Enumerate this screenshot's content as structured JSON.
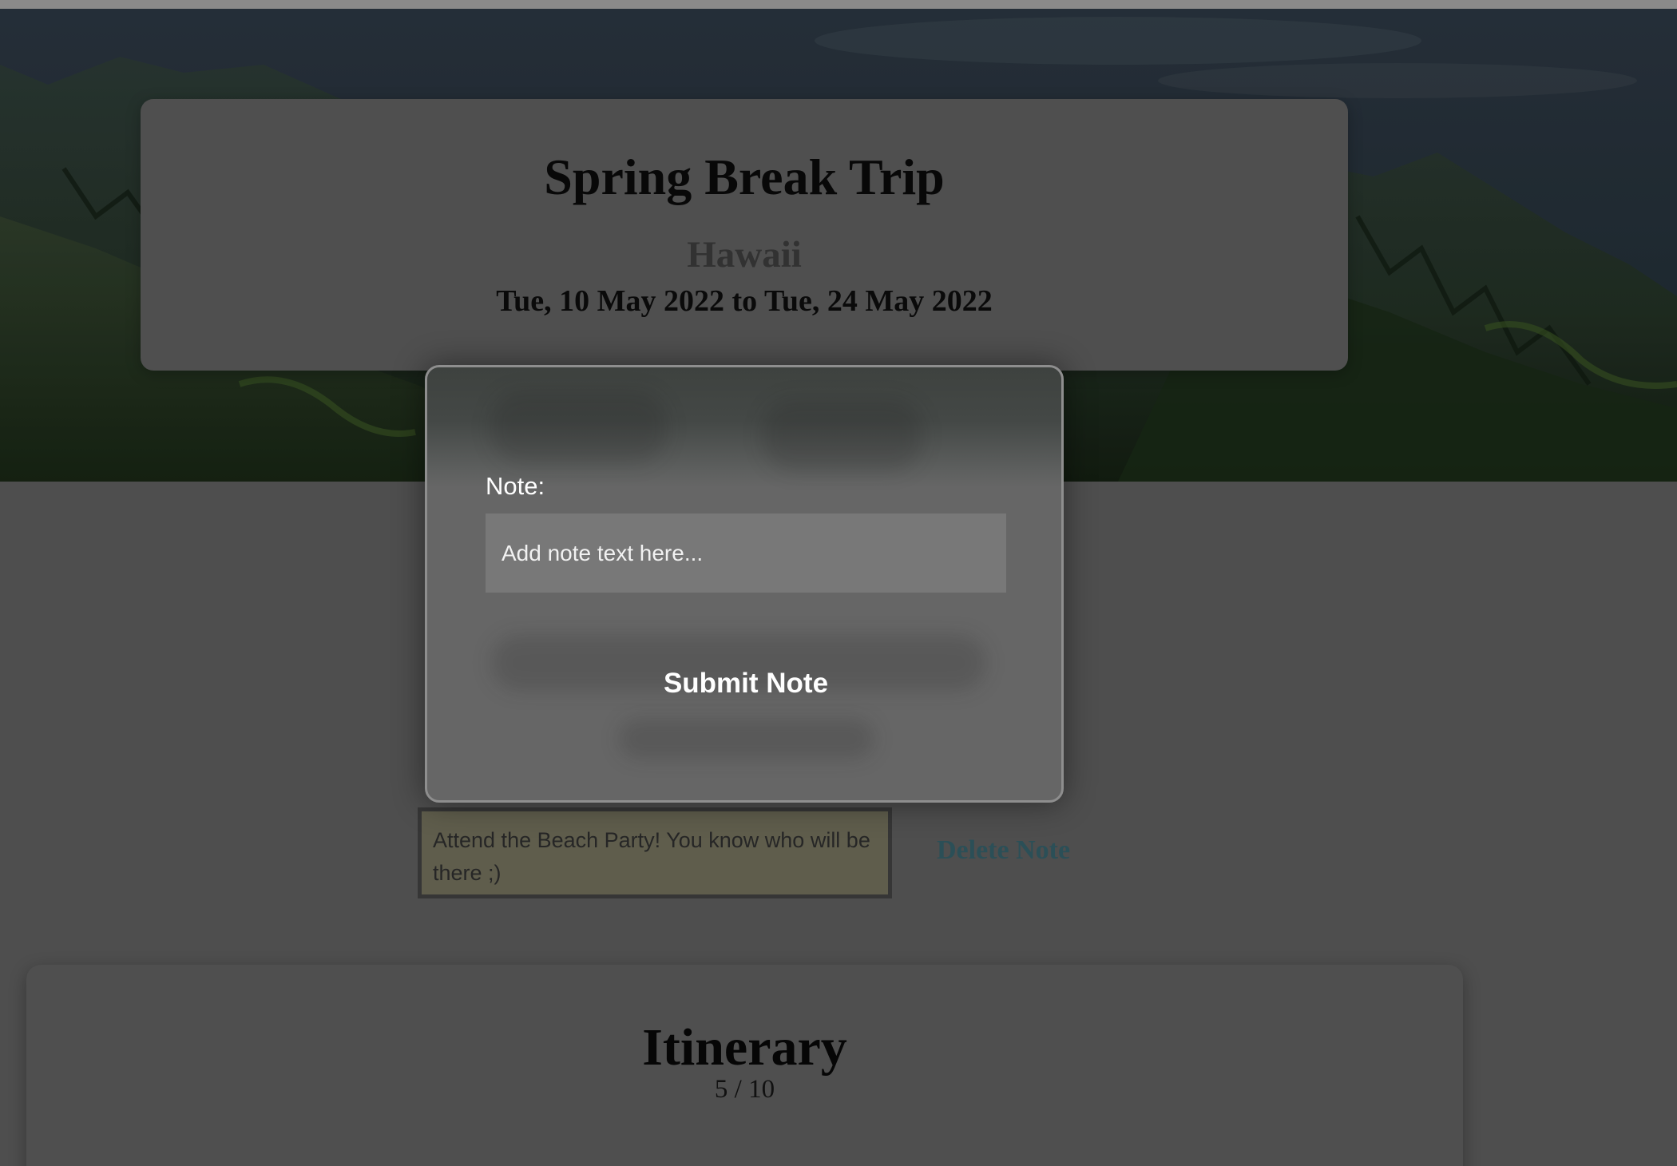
{
  "trip": {
    "title": "Spring Break Trip",
    "destination": "Hawaii",
    "dates": "Tue, 10 May 2022 to Tue, 24 May 2022"
  },
  "note_modal": {
    "label": "Note:",
    "input_placeholder": "Add note text here...",
    "input_value": "",
    "submit_label": "Submit Note"
  },
  "notes": [
    {
      "text": "Attend the Beach Party! You know who will be there ;)",
      "delete_label": "Delete Note"
    }
  ],
  "itinerary": {
    "title": "Itinerary",
    "count": "5 / 10"
  },
  "colors": {
    "overlay_background": "#4e4e4e",
    "note_background": "#5f5d4c",
    "delete_link": "#2b4f57",
    "modal_background": "#666666"
  }
}
